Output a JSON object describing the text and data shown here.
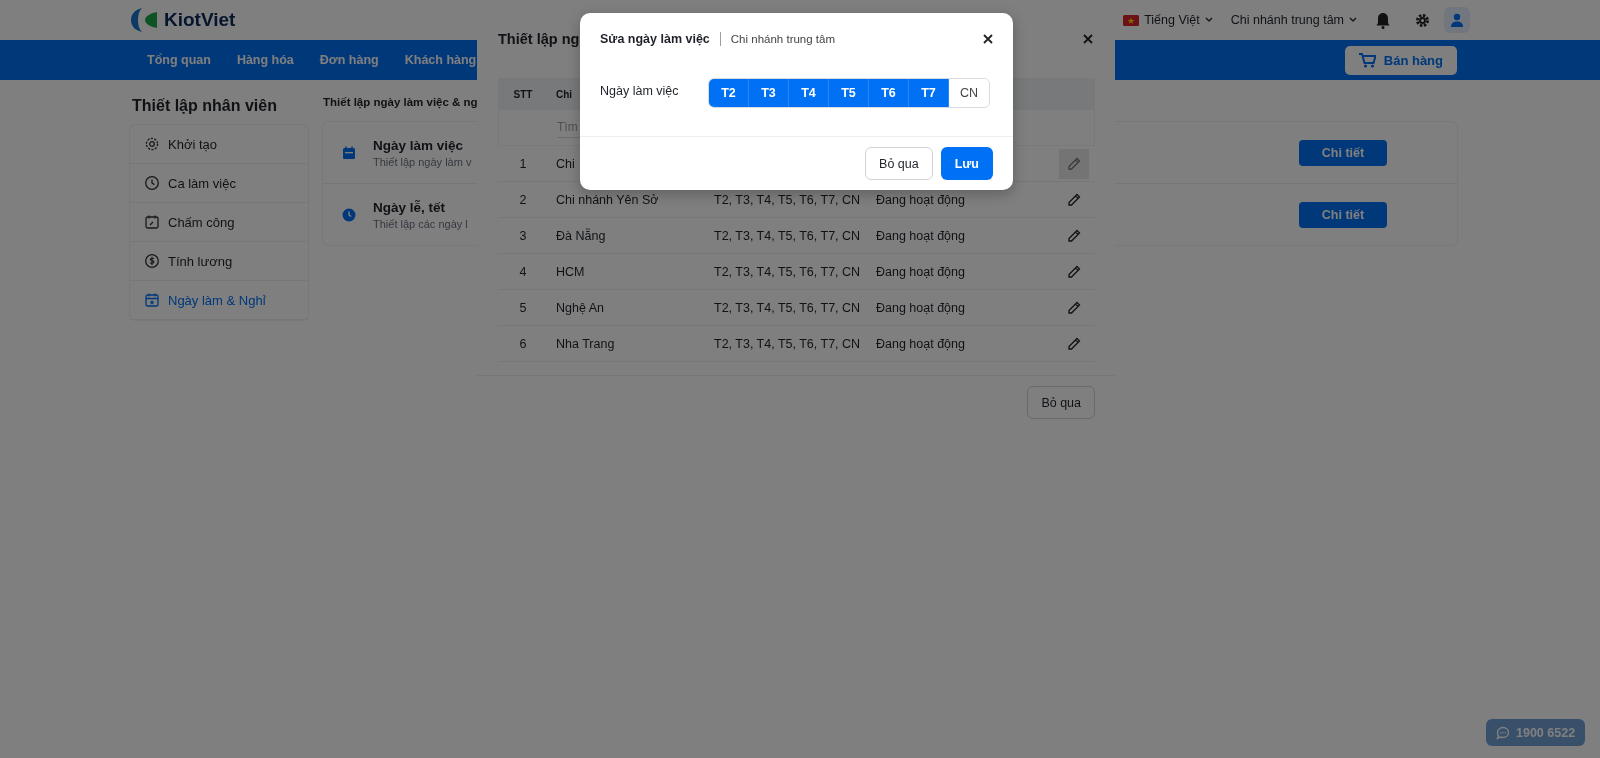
{
  "header": {
    "logo": "KiotViet",
    "language": "Tiếng Việt",
    "branch": "Chi nhánh trung tâm"
  },
  "nav": {
    "items": [
      "Tổng quan",
      "Hàng hóa",
      "Đơn hàng",
      "Khách hàng"
    ],
    "sell_button": "Bán hàng"
  },
  "sidebar": {
    "title": "Thiết lập nhân viên",
    "items": [
      {
        "label": "Khởi tạo",
        "selected": false
      },
      {
        "label": "Ca làm việc",
        "selected": false
      },
      {
        "label": "Chấm công",
        "selected": false
      },
      {
        "label": "Tính lương",
        "selected": false
      },
      {
        "label": "Ngày làm & Nghỉ",
        "selected": true
      }
    ]
  },
  "main": {
    "title": "Thiết lập ngày làm việc & ng",
    "rows": [
      {
        "title": "Ngày làm việc",
        "subtitle": "Thiết lập ngày làm v",
        "button": "Chi tiết"
      },
      {
        "title": "Ngày lễ, tết",
        "subtitle": "Thiết lập các ngày l",
        "button": "Chi tiết"
      }
    ]
  },
  "branch_dialog": {
    "title": "Thiết lập ng",
    "columns": [
      "STT",
      "Chi"
    ],
    "search_placeholder": "Tìm",
    "rows": [
      {
        "stt": "1",
        "name": "Chi",
        "edit_hovered": true
      },
      {
        "stt": "2",
        "name": "Chi nhánh Yên Sở",
        "days": "T2, T3, T4, T5, T6, T7, CN",
        "status": "Đang hoạt động",
        "edit_hovered": false
      },
      {
        "stt": "3",
        "name": "Đà Nẵng",
        "days": "T2, T3, T4, T5, T6, T7, CN",
        "status": "Đang hoạt động",
        "edit_hovered": false
      },
      {
        "stt": "4",
        "name": "HCM",
        "days": "T2, T3, T4, T5, T6, T7, CN",
        "status": "Đang hoạt động",
        "edit_hovered": false
      },
      {
        "stt": "5",
        "name": "Nghệ An",
        "days": "T2, T3, T4, T5, T6, T7, CN",
        "status": "Đang hoạt động",
        "edit_hovered": false
      },
      {
        "stt": "6",
        "name": "Nha Trang",
        "days": "T2, T3, T4, T5, T6, T7, CN",
        "status": "Đang hoạt động",
        "edit_hovered": false
      }
    ],
    "cancel": "Bỏ qua"
  },
  "edit_dialog": {
    "title": "Sửa ngày làm việc",
    "subtitle": "Chi nhánh trung tâm",
    "label": "Ngày làm việc",
    "days": [
      {
        "label": "T2",
        "selected": true
      },
      {
        "label": "T3",
        "selected": true
      },
      {
        "label": "T4",
        "selected": true
      },
      {
        "label": "T5",
        "selected": true
      },
      {
        "label": "T6",
        "selected": true
      },
      {
        "label": "T7",
        "selected": true
      },
      {
        "label": "CN",
        "selected": false
      }
    ],
    "cancel": "Bỏ qua",
    "save": "Lưu"
  },
  "hotline": "1900 6522"
}
